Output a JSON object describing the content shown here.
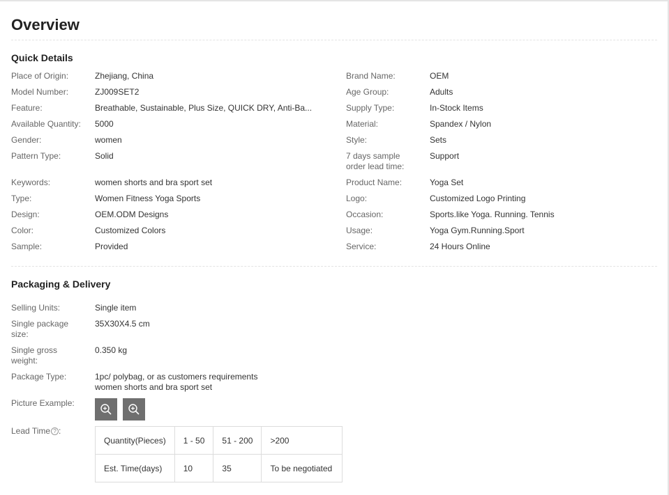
{
  "overview": {
    "title": "Overview"
  },
  "quick_details": {
    "title": "Quick Details",
    "left": [
      {
        "label": "Place of Origin:",
        "value": "Zhejiang, China"
      },
      {
        "label": "Model Number:",
        "value": "ZJ009SET2"
      },
      {
        "label": "Feature:",
        "value": "Breathable, Sustainable, Plus Size, QUICK DRY, Anti-Ba..."
      },
      {
        "label": "Available Quantity:",
        "value": "5000"
      },
      {
        "label": "Gender:",
        "value": "women"
      },
      {
        "label": "Pattern Type:",
        "value": "Solid"
      },
      {
        "label": "Keywords:",
        "value": "women shorts and bra sport set"
      },
      {
        "label": "Type:",
        "value": "Women Fitness Yoga Sports"
      },
      {
        "label": "Design:",
        "value": "OEM.ODM Designs"
      },
      {
        "label": "Color:",
        "value": "Customized Colors"
      },
      {
        "label": "Sample:",
        "value": "Provided"
      }
    ],
    "right": [
      {
        "label": "Brand Name:",
        "value": "OEM"
      },
      {
        "label": "Age Group:",
        "value": "Adults"
      },
      {
        "label": "Supply Type:",
        "value": "In-Stock Items"
      },
      {
        "label": "Material:",
        "value": "Spandex / Nylon"
      },
      {
        "label": "Style:",
        "value": "Sets"
      },
      {
        "label": "7 days sample order lead time:",
        "value": "Support"
      },
      {
        "label": "Product Name:",
        "value": "Yoga Set"
      },
      {
        "label": "Logo:",
        "value": "Customized Logo Printing"
      },
      {
        "label": "Occasion:",
        "value": "Sports.like Yoga. Running. Tennis"
      },
      {
        "label": "Usage:",
        "value": "Yoga Gym.Running.Sport"
      },
      {
        "label": "Service:",
        "value": "24 Hours Online"
      }
    ]
  },
  "packaging": {
    "title": "Packaging & Delivery",
    "selling_units": {
      "label": "Selling Units:",
      "value": "Single item"
    },
    "package_size": {
      "label": "Single package size:",
      "value": "35X30X4.5 cm"
    },
    "gross_weight": {
      "label": "Single gross weight:",
      "value": "0.350 kg"
    },
    "package_type": {
      "label": "Package Type:",
      "value": "1pc/ polybag, or as customers requirements women shorts and bra sport set"
    },
    "picture_example": {
      "label": "Picture Example:"
    },
    "lead_time": {
      "label": "Lead Time",
      "help_glyph": "?",
      "header": [
        "Quantity(Pieces)",
        "1 - 50",
        "51 - 200",
        ">200"
      ],
      "row": [
        "Est. Time(days)",
        "10",
        "35",
        "To be negotiated"
      ]
    }
  },
  "icons": {
    "zoom": "zoom-in-icon",
    "help": "question-circle-icon"
  }
}
